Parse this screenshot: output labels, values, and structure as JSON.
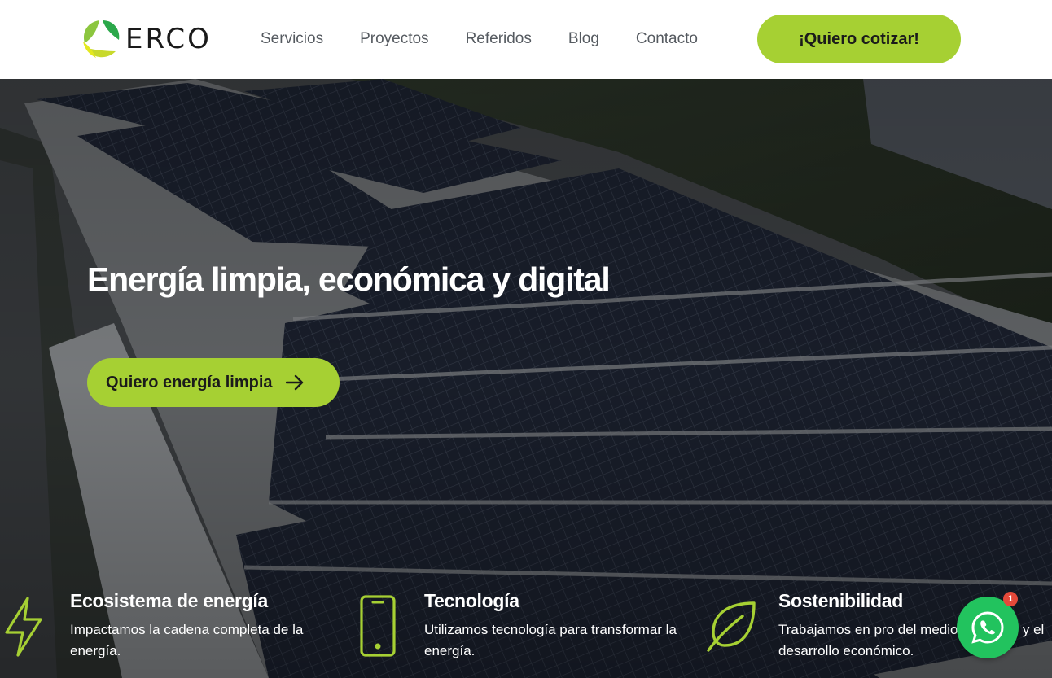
{
  "header": {
    "logo_text": "ERCO",
    "nav": [
      "Servicios",
      "Proyectos",
      "Referidos",
      "Blog",
      "Contacto"
    ],
    "cta_label": "¡Quiero cotizar!"
  },
  "hero": {
    "title": "Energía limpia, económica y digital",
    "cta_label": "Quiero energía limpia"
  },
  "features": [
    {
      "icon": "lightning-icon",
      "title": "Ecosistema de energía",
      "text": "Impactamos la cadena completa de la energía."
    },
    {
      "icon": "phone-icon",
      "title": "Tecnología",
      "text": "Utilizamos tecnología para transformar la energía."
    },
    {
      "icon": "leaf-icon",
      "title": "Sostenibilidad",
      "text": "Trabajamos en pro del medio ambiente y el desarrollo económico."
    }
  ],
  "whatsapp": {
    "badge_count": "1"
  },
  "colors": {
    "accent": "#a6d033",
    "whatsapp": "#22c35e",
    "badge": "#e5493a"
  }
}
